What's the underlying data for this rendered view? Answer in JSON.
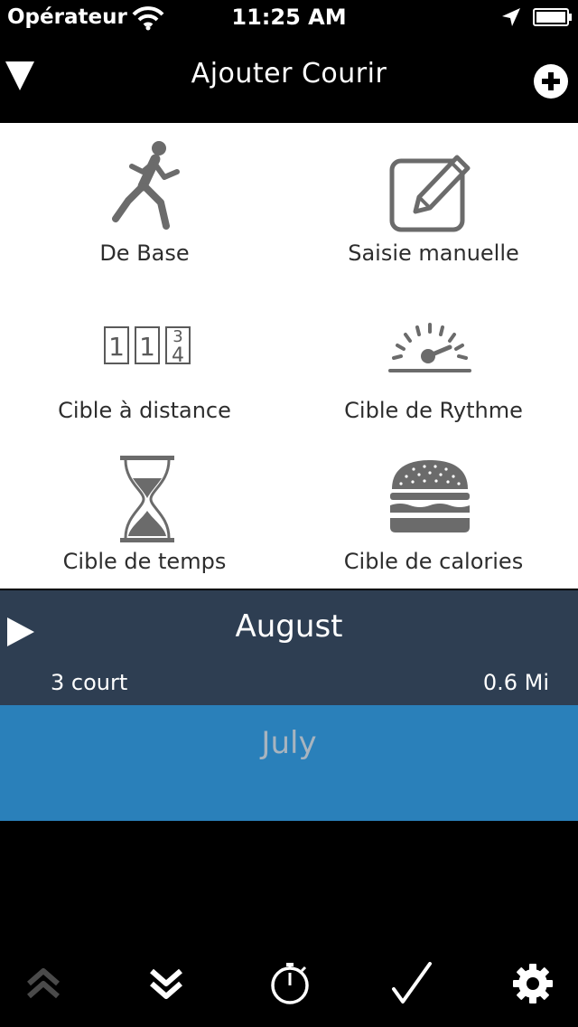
{
  "status_bar": {
    "carrier": "Opérateur",
    "time": "11:25 AM",
    "icons": [
      "wifi-icon",
      "location-icon",
      "battery-icon"
    ]
  },
  "nav": {
    "title": "Ajouter Courir",
    "left_icon": "triangle-down-icon",
    "right_icon": "plus-circle-icon"
  },
  "workouts": [
    {
      "label": "De Base",
      "icon": "runner-icon"
    },
    {
      "label": "Saisie manuelle",
      "icon": "pencil-square-icon"
    },
    {
      "label": "Cible à distance",
      "icon": "odometer-icon",
      "icon_text": [
        "1",
        "1",
        "3",
        "4"
      ]
    },
    {
      "label": "Cible de Rythme",
      "icon": "speedometer-icon"
    },
    {
      "label": "Cible de temps",
      "icon": "hourglass-icon"
    },
    {
      "label": "Cible de calories",
      "icon": "burger-icon"
    }
  ],
  "months": [
    {
      "name": "August",
      "count": "3 court",
      "distance": "0.6 Mi",
      "expanded": false,
      "color": "#2e3e52"
    },
    {
      "name": "July",
      "color": "#2a80ba"
    }
  ],
  "tabs": [
    {
      "icon": "chevrons-up-icon",
      "enabled": false
    },
    {
      "icon": "chevrons-down-icon",
      "enabled": true
    },
    {
      "icon": "stopwatch-icon",
      "enabled": true
    },
    {
      "icon": "checkmark-icon",
      "enabled": true
    },
    {
      "icon": "gear-icon",
      "enabled": true
    }
  ]
}
